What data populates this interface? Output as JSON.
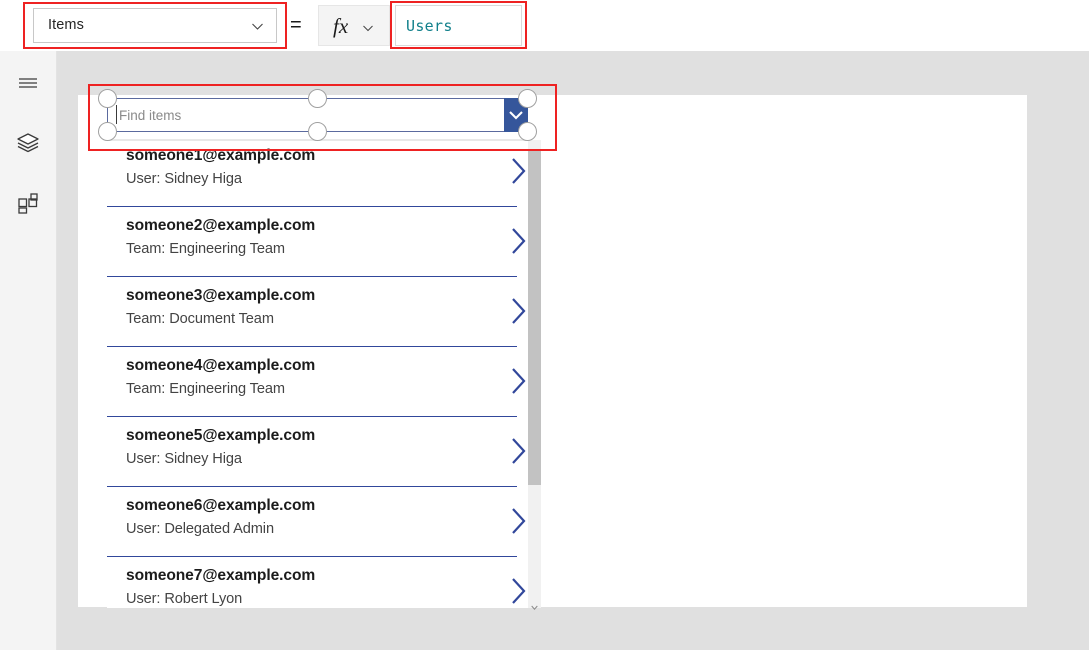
{
  "topbar": {
    "property_dropdown": {
      "value": "Items",
      "icon": "chevron-down-icon"
    },
    "equals_sign": "=",
    "fx_button": {
      "label": "fx",
      "icon": "chevron-down-icon"
    },
    "formula_input": {
      "value": "Users",
      "text_color": "#12808b"
    }
  },
  "rail": {
    "items": [
      {
        "name": "menu-icon",
        "label": "Menu"
      },
      {
        "name": "layers-icon",
        "label": "Tree view"
      },
      {
        "name": "components-icon",
        "label": "Insert"
      }
    ]
  },
  "search_control": {
    "placeholder": "Find items",
    "value": "",
    "dropdown_icon": "chevron-down-icon",
    "dropdown_color": "#35569b",
    "selected": true,
    "handles": 6
  },
  "gallery": {
    "separator_color": "#31479b",
    "chevron_color": "#31479b",
    "items": [
      {
        "title": "someone1@example.com",
        "subtitle": "User: Sidney Higa"
      },
      {
        "title": "someone2@example.com",
        "subtitle": "Team: Engineering Team"
      },
      {
        "title": "someone3@example.com",
        "subtitle": "Team: Document Team"
      },
      {
        "title": "someone4@example.com",
        "subtitle": "Team: Engineering Team"
      },
      {
        "title": "someone5@example.com",
        "subtitle": "User: Sidney Higa"
      },
      {
        "title": "someone6@example.com",
        "subtitle": "User: Delegated Admin"
      },
      {
        "title": "someone7@example.com",
        "subtitle": "User: Robert Lyon"
      }
    ]
  },
  "scrollbar": {
    "up_arrow": "scroll-up-arrow-icon",
    "down_arrow": "scroll-down-arrow-icon"
  },
  "annotations": {
    "highlight_color": "#ee2222",
    "boxes": [
      "property-dropdown-highlight",
      "formula-input-highlight",
      "search-control-highlight"
    ]
  }
}
